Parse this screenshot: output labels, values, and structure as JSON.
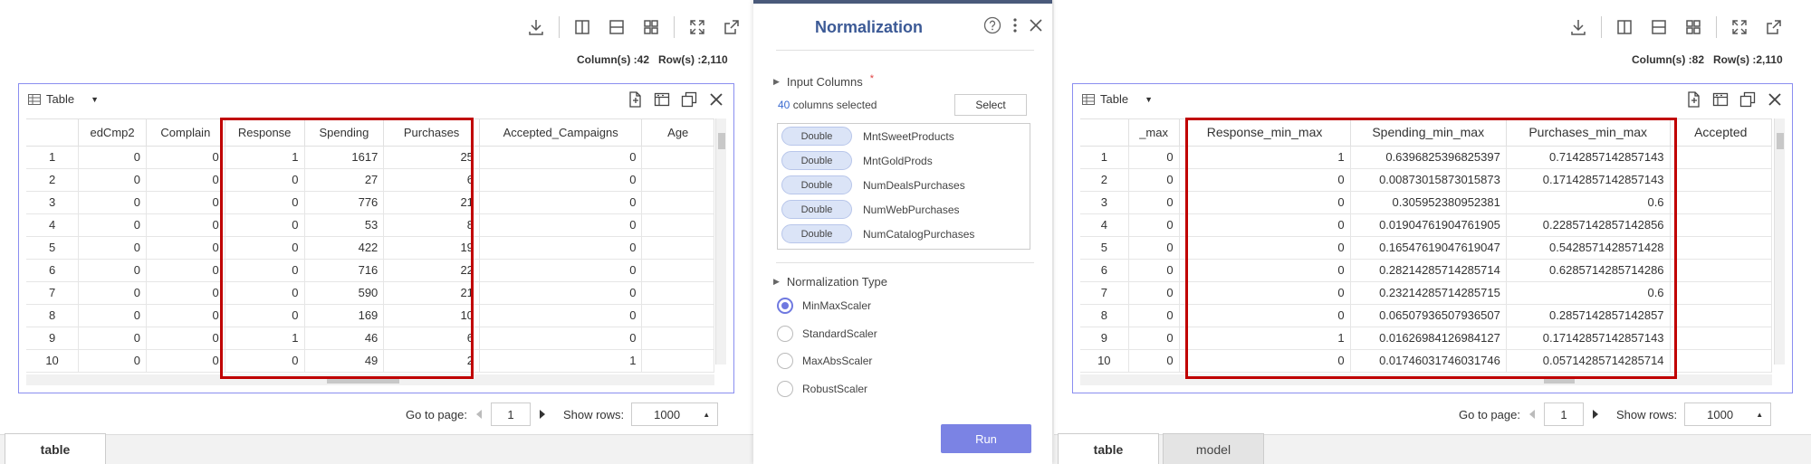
{
  "left": {
    "toolbar_icons": [
      "download-icon",
      "split-columns-icon",
      "split-rows-icon",
      "grid-layout-icon",
      "expand-icon",
      "open-external-icon"
    ],
    "columns_count": "Column(s) :42",
    "rows_count": "Row(s) :2,110",
    "panel_title": "Table",
    "headers": [
      "edCmp2",
      "Complain",
      "Response",
      "Spending",
      "Purchases",
      "Accepted_Campaigns",
      "Age"
    ],
    "rows": [
      [
        "1",
        "0",
        "0",
        "1",
        "1617",
        "25",
        "0",
        ""
      ],
      [
        "2",
        "0",
        "0",
        "0",
        "27",
        "6",
        "0",
        ""
      ],
      [
        "3",
        "0",
        "0",
        "0",
        "776",
        "21",
        "0",
        ""
      ],
      [
        "4",
        "0",
        "0",
        "0",
        "53",
        "8",
        "0",
        ""
      ],
      [
        "5",
        "0",
        "0",
        "0",
        "422",
        "19",
        "0",
        ""
      ],
      [
        "6",
        "0",
        "0",
        "0",
        "716",
        "22",
        "0",
        ""
      ],
      [
        "7",
        "0",
        "0",
        "0",
        "590",
        "21",
        "0",
        ""
      ],
      [
        "8",
        "0",
        "0",
        "0",
        "169",
        "10",
        "0",
        ""
      ],
      [
        "9",
        "0",
        "0",
        "1",
        "46",
        "6",
        "0",
        ""
      ],
      [
        "10",
        "0",
        "0",
        "0",
        "49",
        "2",
        "1",
        ""
      ]
    ],
    "goto_label": "Go to page:",
    "page_value": "1",
    "show_rows_label": "Show rows:",
    "show_rows_value": "1000",
    "tabs": [
      "table"
    ]
  },
  "middle": {
    "title": "Normalization",
    "input_columns_label": "Input Columns",
    "required_mark": "*",
    "selected_count": "40",
    "selected_suffix": "columns selected",
    "select_button": "Select",
    "columns": [
      {
        "type": "Double",
        "name": "MntSweetProducts"
      },
      {
        "type": "Double",
        "name": "MntGoldProds"
      },
      {
        "type": "Double",
        "name": "NumDealsPurchases"
      },
      {
        "type": "Double",
        "name": "NumWebPurchases"
      },
      {
        "type": "Double",
        "name": "NumCatalogPurchases"
      }
    ],
    "normalization_type_label": "Normalization Type",
    "options": [
      "MinMaxScaler",
      "StandardScaler",
      "MaxAbsScaler",
      "RobustScaler"
    ],
    "selected_option": "MinMaxScaler",
    "run_button": "Run"
  },
  "right": {
    "columns_count": "Column(s) :82",
    "rows_count": "Row(s) :2,110",
    "panel_title": "Table",
    "headers": [
      "_max",
      "Response_min_max",
      "Spending_min_max",
      "Purchases_min_max",
      "Accepted"
    ],
    "rows": [
      [
        "1",
        "0",
        "1",
        "0.6396825396825397",
        "0.7142857142857143",
        ""
      ],
      [
        "2",
        "0",
        "0",
        "0.00873015873015873",
        "0.17142857142857143",
        ""
      ],
      [
        "3",
        "0",
        "0",
        "0.305952380952381",
        "0.6",
        ""
      ],
      [
        "4",
        "0",
        "0",
        "0.01904761904761905",
        "0.22857142857142856",
        ""
      ],
      [
        "5",
        "0",
        "0",
        "0.16547619047619047",
        "0.5428571428571428",
        ""
      ],
      [
        "6",
        "0",
        "0",
        "0.28214285714285714",
        "0.6285714285714286",
        ""
      ],
      [
        "7",
        "0",
        "0",
        "0.23214285714285715",
        "0.6",
        ""
      ],
      [
        "8",
        "0",
        "0",
        "0.06507936507936507",
        "0.2857142857142857",
        ""
      ],
      [
        "9",
        "0",
        "1",
        "0.01626984126984127",
        "0.17142857142857143",
        ""
      ],
      [
        "10",
        "0",
        "0",
        "0.01746031746031746",
        "0.05714285714285714",
        ""
      ]
    ],
    "goto_label": "Go to page:",
    "page_value": "1",
    "show_rows_label": "Show rows:",
    "show_rows_value": "1000",
    "tabs": [
      "table",
      "model"
    ]
  },
  "colors": {
    "accent": "#7b83e4",
    "highlight_box": "#c00000",
    "panel_border": "#8a8ef0",
    "title": "#3c5a96"
  }
}
